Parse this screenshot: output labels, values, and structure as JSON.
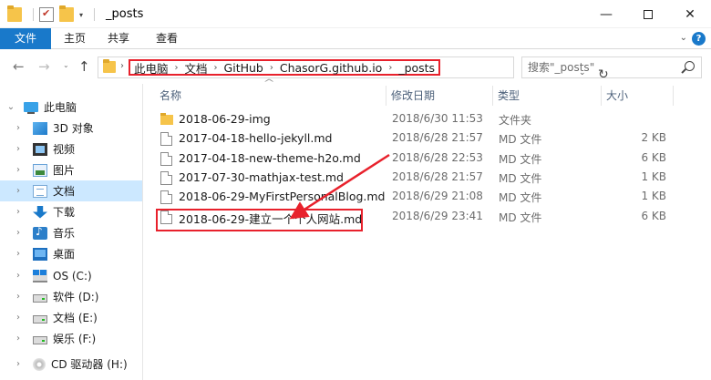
{
  "window": {
    "title": "_posts",
    "minimize_glyph": "—",
    "close_glyph": "✕"
  },
  "ribbon": {
    "tabs": [
      "文件",
      "主页",
      "共享",
      "查看"
    ],
    "expand_glyph": "⌄",
    "help_glyph": "?"
  },
  "navigation": {
    "back_glyph": "←",
    "forward_glyph": "→",
    "recent_glyph": "⌄",
    "up_glyph": "↑",
    "breadcrumbs": [
      "此电脑",
      "文档",
      "GitHub",
      "ChasorG.github.io",
      "_posts"
    ],
    "separator": "›",
    "dropdown_glyph": "⌄",
    "refresh_glyph": "↻",
    "search_placeholder": "搜索\"_posts\""
  },
  "sidebar": {
    "items": [
      {
        "label": "此电脑",
        "icon": "pc-icon",
        "expanded": true
      },
      {
        "label": "3D 对象",
        "icon": "3d-objects-icon"
      },
      {
        "label": "视频",
        "icon": "video-icon"
      },
      {
        "label": "图片",
        "icon": "pictures-icon"
      },
      {
        "label": "文档",
        "icon": "documents-icon",
        "selected": true
      },
      {
        "label": "下载",
        "icon": "downloads-icon"
      },
      {
        "label": "音乐",
        "icon": "music-icon"
      },
      {
        "label": "桌面",
        "icon": "desktop-icon"
      },
      {
        "label": "OS (C:)",
        "icon": "os-drive-icon"
      },
      {
        "label": "软件 (D:)",
        "icon": "drive-icon"
      },
      {
        "label": "文档 (E:)",
        "icon": "drive-icon"
      },
      {
        "label": "娱乐 (F:)",
        "icon": "drive-icon"
      },
      {
        "label": "CD 驱动器 (H:)",
        "icon": "cd-drive-icon"
      }
    ],
    "collapsed_chevron": "›",
    "expanded_chevron": "⌄"
  },
  "file_list": {
    "columns": {
      "name": "名称",
      "date": "修改日期",
      "type": "类型",
      "size": "大小"
    },
    "sort_arrow": "^",
    "rows": [
      {
        "name": "2018-06-29-img",
        "date": "2018/6/30 11:53",
        "type": "文件夹",
        "size": "",
        "kind": "folder"
      },
      {
        "name": "2017-04-18-hello-jekyll.md",
        "date": "2018/6/28 21:57",
        "type": "MD 文件",
        "size": "2 KB",
        "kind": "md"
      },
      {
        "name": "2017-04-18-new-theme-h2o.md",
        "date": "2018/6/28 22:53",
        "type": "MD 文件",
        "size": "6 KB",
        "kind": "md"
      },
      {
        "name": "2017-07-30-mathjax-test.md",
        "date": "2018/6/28 21:57",
        "type": "MD 文件",
        "size": "1 KB",
        "kind": "md"
      },
      {
        "name": "2018-06-29-MyFirstPersonalBlog.md",
        "date": "2018/6/29 21:08",
        "type": "MD 文件",
        "size": "1 KB",
        "kind": "md"
      },
      {
        "name": "2018-06-29-建立一个个人网站.md",
        "date": "2018/6/29 23:41",
        "type": "MD 文件",
        "size": "6 KB",
        "kind": "md",
        "annotated": true
      }
    ]
  },
  "annotation": {
    "color": "#e8212c"
  }
}
